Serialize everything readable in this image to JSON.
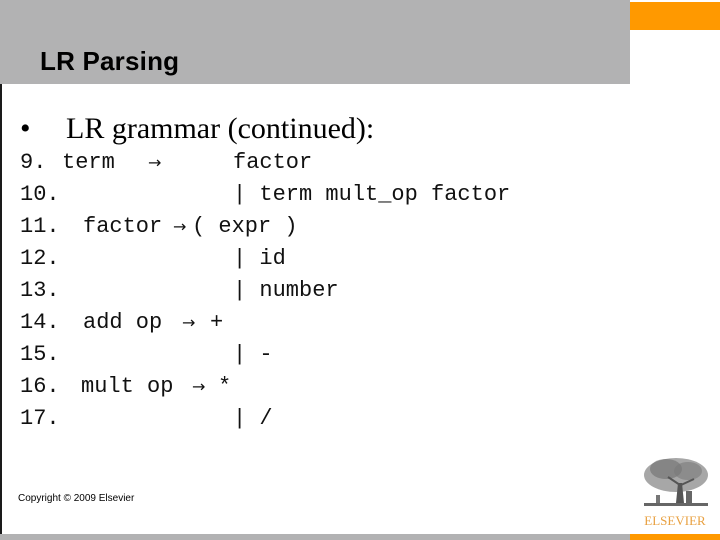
{
  "slide": {
    "title": "LR Parsing",
    "bullet": {
      "marker": "•",
      "text": "LR grammar (continued):"
    },
    "grammar_lines": [
      {
        "num": "9.",
        "lhs": "term",
        "arrow": "→",
        "rhs": "factor"
      },
      {
        "num": "10.",
        "lhs": "",
        "arrow": "",
        "rhs": "| term mult_op factor"
      },
      {
        "num": "11.",
        "lhs": "factor",
        "arrow": "→",
        "rhs": "( expr )"
      },
      {
        "num": "12.",
        "lhs": "",
        "arrow": "",
        "rhs": "| id"
      },
      {
        "num": "13.",
        "lhs": "",
        "arrow": "",
        "rhs": "| number"
      },
      {
        "num": "14.",
        "lhs": "add op",
        "arrow": "→",
        "rhs": "+"
      },
      {
        "num": "15.",
        "lhs": "",
        "arrow": "",
        "rhs": "| -"
      },
      {
        "num": "16.",
        "lhs": "mult op",
        "arrow": "→",
        "rhs": "*"
      },
      {
        "num": "17.",
        "lhs": "",
        "arrow": "",
        "rhs": "| /"
      }
    ],
    "footer": "Copyright © 2009 Elsevier",
    "logo": {
      "icon": "elsevier-tree-icon",
      "wordmark": "ELSEVIER"
    }
  },
  "colors": {
    "header_gray": "#b2b2b3",
    "accent_orange": "#ff9900",
    "logo_text": "#e8a040"
  }
}
